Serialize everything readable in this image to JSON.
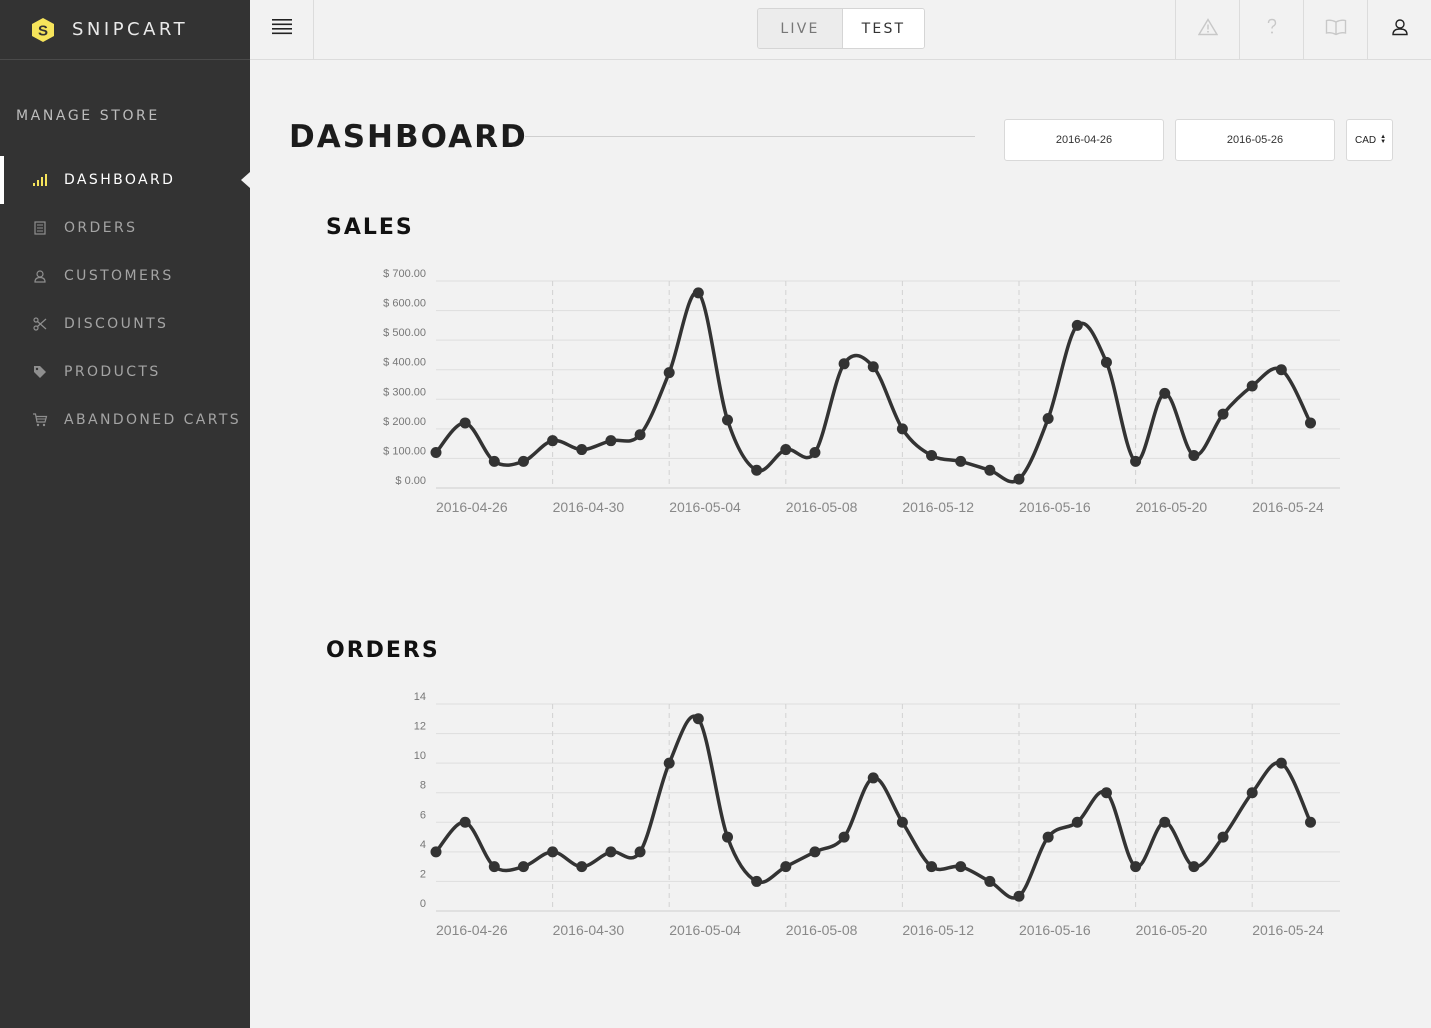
{
  "brand": {
    "name": "SNIPCART",
    "logo_icon": "snipcart-logo-icon",
    "accent": "#f6e45b"
  },
  "sidebar": {
    "section_title": "MANAGE STORE",
    "items": [
      {
        "label": "DASHBOARD",
        "icon": "bar-chart-icon",
        "active": true
      },
      {
        "label": "ORDERS",
        "icon": "receipt-icon",
        "active": false
      },
      {
        "label": "CUSTOMERS",
        "icon": "person-icon",
        "active": false
      },
      {
        "label": "DISCOUNTS",
        "icon": "scissors-icon",
        "active": false
      },
      {
        "label": "PRODUCTS",
        "icon": "tag-icon",
        "active": false
      },
      {
        "label": "ABANDONED CARTS",
        "icon": "cart-icon",
        "active": false
      }
    ]
  },
  "topbar": {
    "menu_icon": "hamburger-menu-icon",
    "modes": {
      "live": "LIVE",
      "test": "TEST",
      "selected": "TEST"
    },
    "icons": [
      "warning-icon",
      "help-icon",
      "docs-book-icon",
      "account-icon"
    ]
  },
  "main": {
    "title": "DASHBOARD",
    "date_from": "2016-04-26",
    "date_to": "2016-05-26",
    "currency": "CAD",
    "sales_title": "SALES",
    "orders_title": "ORDERS"
  },
  "chart_data": [
    {
      "type": "line",
      "title": "SALES",
      "x": [
        "2016-04-26",
        "2016-04-27",
        "2016-04-28",
        "2016-04-29",
        "2016-04-30",
        "2016-05-01",
        "2016-05-02",
        "2016-05-03",
        "2016-05-04",
        "2016-05-05",
        "2016-05-06",
        "2016-05-07",
        "2016-05-08",
        "2016-05-09",
        "2016-05-10",
        "2016-05-11",
        "2016-05-12",
        "2016-05-13",
        "2016-05-14",
        "2016-05-15",
        "2016-05-16",
        "2016-05-17",
        "2016-05-18",
        "2016-05-19",
        "2016-05-20",
        "2016-05-21",
        "2016-05-22",
        "2016-05-23",
        "2016-05-24",
        "2016-05-25",
        "2016-05-26"
      ],
      "x_ticks": [
        "2016-04-26",
        "2016-04-30",
        "2016-05-04",
        "2016-05-08",
        "2016-05-12",
        "2016-05-16",
        "2016-05-20",
        "2016-05-24"
      ],
      "series": [
        {
          "values": [
            120,
            220,
            90,
            90,
            160,
            130,
            160,
            180,
            390,
            660,
            230,
            60,
            130,
            120,
            420,
            410,
            200,
            110,
            90,
            60,
            30,
            235,
            550,
            425,
            90,
            320,
            110,
            250,
            345,
            400,
            220
          ]
        }
      ],
      "y_ticks": [
        "$ 0.00",
        "$ 100.00",
        "$ 200.00",
        "$ 300.00",
        "$ 400.00",
        "$ 500.00",
        "$ 600.00",
        "$ 700.00"
      ],
      "ylim": [
        0,
        700
      ],
      "grid": true,
      "line_color": "#333333"
    },
    {
      "type": "line",
      "title": "ORDERS",
      "x": [
        "2016-04-26",
        "2016-04-27",
        "2016-04-28",
        "2016-04-29",
        "2016-04-30",
        "2016-05-01",
        "2016-05-02",
        "2016-05-03",
        "2016-05-04",
        "2016-05-05",
        "2016-05-06",
        "2016-05-07",
        "2016-05-08",
        "2016-05-09",
        "2016-05-10",
        "2016-05-11",
        "2016-05-12",
        "2016-05-13",
        "2016-05-14",
        "2016-05-15",
        "2016-05-16",
        "2016-05-17",
        "2016-05-18",
        "2016-05-19",
        "2016-05-20",
        "2016-05-21",
        "2016-05-22",
        "2016-05-23",
        "2016-05-24",
        "2016-05-25",
        "2016-05-26"
      ],
      "x_ticks": [
        "2016-04-26",
        "2016-04-30",
        "2016-05-04",
        "2016-05-08",
        "2016-05-12",
        "2016-05-16",
        "2016-05-20",
        "2016-05-24"
      ],
      "series": [
        {
          "values": [
            4,
            6,
            3,
            3,
            4,
            3,
            4,
            4,
            10,
            13,
            5,
            2,
            3,
            4,
            5,
            9,
            6,
            3,
            3,
            2,
            1,
            5,
            6,
            8,
            3,
            6,
            3,
            5,
            8,
            10,
            6
          ]
        }
      ],
      "y_ticks": [
        "0",
        "2",
        "4",
        "6",
        "8",
        "10",
        "12",
        "14"
      ],
      "ylim": [
        0,
        14
      ],
      "grid": true,
      "line_color": "#333333"
    }
  ]
}
